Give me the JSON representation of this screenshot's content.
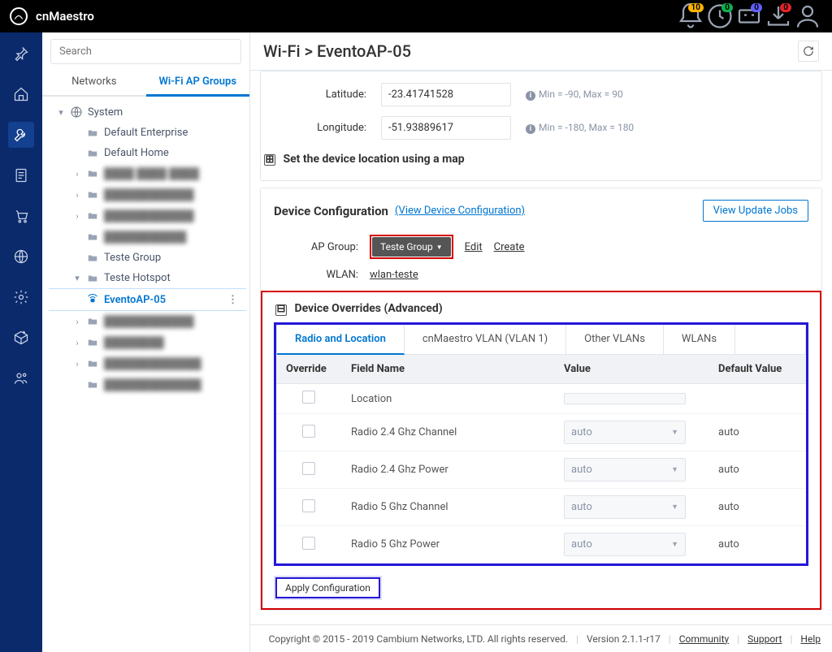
{
  "header": {
    "brand": "cnMaestro",
    "badges": {
      "notifications": "10",
      "clock": "0",
      "switch": "0",
      "download": "0"
    }
  },
  "search": {
    "placeholder": "Search"
  },
  "sidetabs": {
    "networks": "Networks",
    "apgroups": "Wi-Fi AP Groups"
  },
  "tree": {
    "root": "System",
    "enterprise": "Default Enterprise",
    "home": "Default Home",
    "testegroup": "Teste Group",
    "testehotspot": "Teste Hotspot",
    "device": "EventoAP-05"
  },
  "page": {
    "title": "Wi-Fi > EventoAP-05",
    "latitude_label": "Latitude:",
    "latitude_value": "-23.41741528",
    "latitude_hint": "Min = -90, Max = 90",
    "longitude_label": "Longitude:",
    "longitude_value": "-51.93889617",
    "longitude_hint": "Min = -180, Max = 180",
    "maplink": "Set the device location using a map",
    "devcfg": {
      "title": "Device Configuration",
      "viewlink": "(View Device Configuration)",
      "updatejobs": "View Update Jobs",
      "apgroup_label": "AP Group:",
      "apgroup_btn": "Teste Group",
      "edit": "Edit",
      "create": "Create",
      "wlan_label": "WLAN:",
      "wlan_value": "wlan-teste"
    },
    "overrides": {
      "title": "Device Overrides (Advanced)",
      "tabs": {
        "radio": "Radio and Location",
        "vlan1": "cnMaestro VLAN (VLAN 1)",
        "other": "Other VLANs",
        "wlans": "WLANs"
      },
      "cols": {
        "override": "Override",
        "field": "Field Name",
        "value": "Value",
        "default": "Default Value"
      },
      "rows": [
        {
          "field": "Location",
          "value": "",
          "default": "",
          "type": "text"
        },
        {
          "field": "Radio 2.4 Ghz Channel",
          "value": "auto",
          "default": "auto",
          "type": "select"
        },
        {
          "field": "Radio 2.4 Ghz Power",
          "value": "auto",
          "default": "auto",
          "type": "select"
        },
        {
          "field": "Radio 5 Ghz Channel",
          "value": "auto",
          "default": "auto",
          "type": "select"
        },
        {
          "field": "Radio 5 Ghz Power",
          "value": "auto",
          "default": "auto",
          "type": "select"
        }
      ],
      "apply": "Apply Configuration"
    }
  },
  "footer": {
    "copyright": "Copyright © 2015 - 2019 Cambium Networks, LTD. All rights reserved.",
    "version": "Version 2.1.1-r17",
    "community": "Community",
    "support": "Support",
    "help": "Help"
  }
}
